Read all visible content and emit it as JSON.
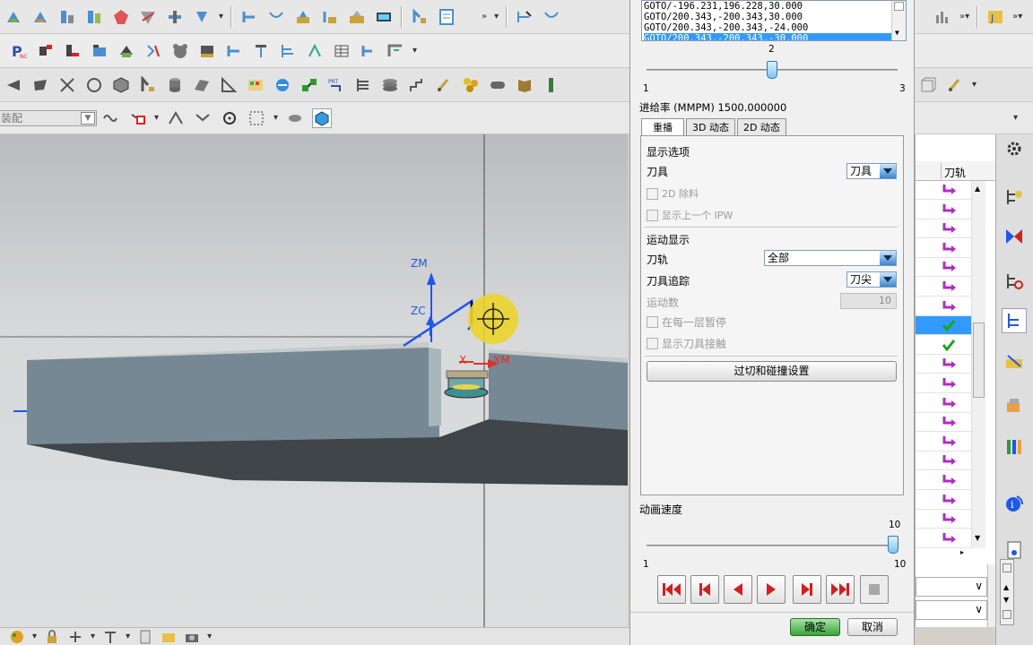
{
  "top_toolbar": {
    "overflow": "»"
  },
  "assembly_toolbar": {
    "filter_value": "装配"
  },
  "viewport": {
    "axes": {
      "zm": "ZM",
      "zc": "ZC",
      "xm": "XM",
      "xc": "X"
    }
  },
  "dialog": {
    "code_lines": [
      "GOTO/-196.231,196.228,30.000",
      "GOTO/200.343,-200.343,30.000",
      "GOTO/200.343,-200.343,-24.000",
      "GOTO/200.343,-200.343,-30.000"
    ],
    "level_slider": {
      "min": "1",
      "max": "3",
      "value": "2",
      "value_num": 2
    },
    "feed_rate": "进给率 (MMPM) 1500.000000",
    "tabs": [
      "重播",
      "3D 动态",
      "2D 动态"
    ],
    "display_options": {
      "header": "显示选项",
      "tool_label": "刀具",
      "tool_value": "刀具",
      "cb_2d_remove": "2D 除料",
      "cb_prev_ipw": "显示上一个 IPW"
    },
    "motion_display": {
      "header": "运动显示",
      "path_label": "刀轨",
      "path_value": "全部",
      "trace_label": "刀具追踪",
      "trace_value": "刀尖",
      "motion_count_label": "运动数",
      "motion_count_value": "10",
      "cb_pause": "在每一层暂停",
      "cb_contact": "显示刀具接触"
    },
    "gouge_button": "过切和碰撞设置",
    "speed": {
      "label": "动画速度",
      "min": "1",
      "max": "10",
      "value": "10",
      "value_num": 10
    },
    "ok": "确定",
    "cancel": "取消"
  },
  "navigator": {
    "column_header": "刀轨",
    "rows": [
      "path",
      "path",
      "path",
      "path",
      "path",
      "path",
      "path",
      "check-selected",
      "check",
      "path",
      "path",
      "path",
      "path",
      "path",
      "path",
      "path",
      "path",
      "path",
      "path"
    ]
  },
  "colors": {
    "path_arrow": "#b02cc6",
    "check": "#1aa61a",
    "selected": "#3399ff",
    "axis_blue": "#1f57e8",
    "axis_red": "#e03030"
  }
}
